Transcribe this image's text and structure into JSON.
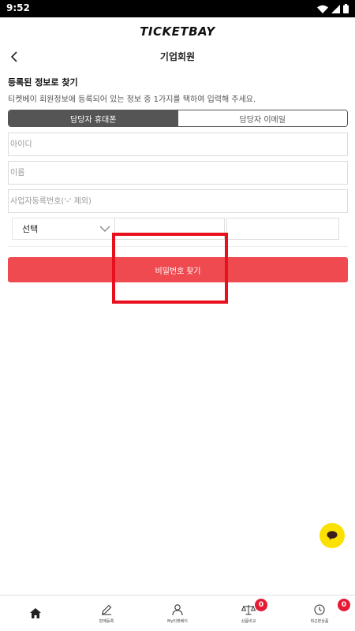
{
  "status_bar": {
    "time": "9:52"
  },
  "brand": {
    "logo": "TICKETBAY"
  },
  "header": {
    "title": "기업회원"
  },
  "section": {
    "title": "등록된 정보로 찾기",
    "description": "티켓베이 회원정보에 등록되어 있는 정보 중 1가지를 택하여 입력해 주세요."
  },
  "tabs": [
    {
      "label": "담당자 휴대폰",
      "active": true
    },
    {
      "label": "담당자 이메일",
      "active": false
    }
  ],
  "form": {
    "id_placeholder": "아이디",
    "name_placeholder": "이름",
    "business_number_placeholder": "사업자등록번호('-' 제외)",
    "carrier_select_value": "선택",
    "phone_middle_value": "",
    "phone_last_value": ""
  },
  "submit": {
    "label": "비밀번호 찾기"
  },
  "bottom_nav": {
    "items": [
      {
        "label": "",
        "icon": "home-icon"
      },
      {
        "label": "판매등록",
        "icon": "pencil-icon"
      },
      {
        "label": "My티켓베이",
        "icon": "person-icon"
      },
      {
        "label": "상품비교",
        "icon": "scale-icon",
        "badge": "0"
      },
      {
        "label": "최근본상품",
        "icon": "clock-icon",
        "badge": "0"
      }
    ]
  },
  "colors": {
    "accent": "#ef4a4f",
    "highlight": "#e8101c",
    "active_tab": "#555555",
    "chat_fab": "#fae100",
    "badge": "#e51b35"
  }
}
